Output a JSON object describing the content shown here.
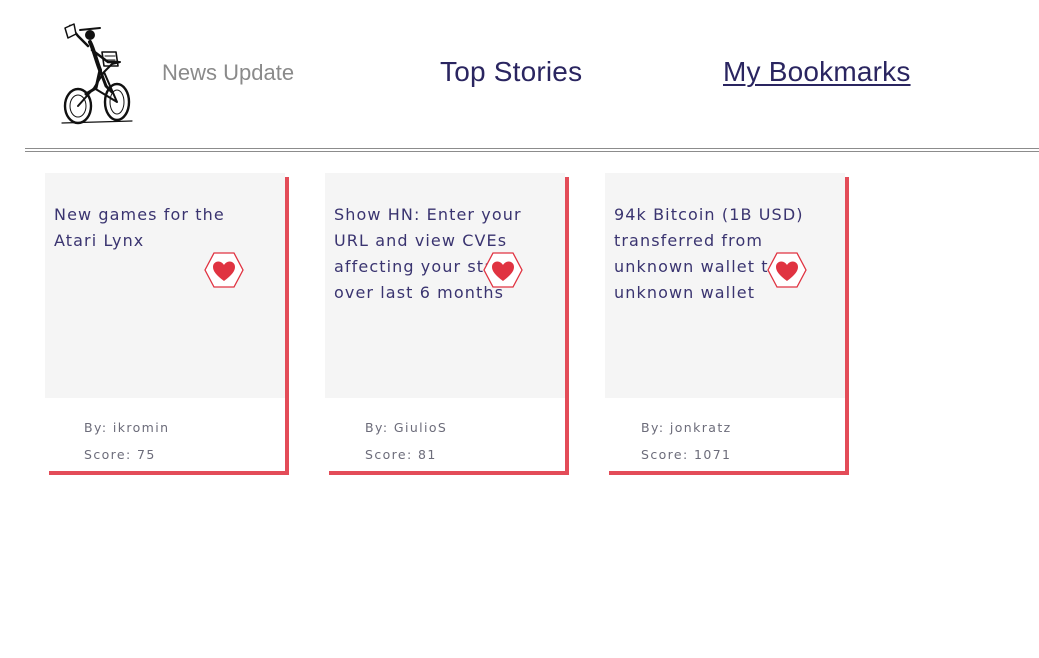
{
  "header": {
    "brand": "News Update",
    "nav": {
      "top_stories": "Top Stories",
      "bookmarks": "My Bookmarks"
    }
  },
  "colors": {
    "nav_text": "#2a2560",
    "card_shadow": "#e34c58",
    "heart": "#e03341",
    "card_bg": "#f5f5f5"
  },
  "stories": [
    {
      "title": "New games for the Atari Lynx",
      "author_prefix": "By:",
      "author": "ikromin",
      "score_prefix": "Score:",
      "score": "75",
      "action_icon": "heart-icon"
    },
    {
      "title": "Show HN: Enter your URL and view CVEs affecting your stack over last 6 months",
      "author_prefix": "By:",
      "author": "GiulioS",
      "score_prefix": "Score:",
      "score": "81",
      "action_icon": "heart-icon"
    },
    {
      "title": "94k Bitcoin (1B USD) transferred from unknown wallet to unknown wallet",
      "author_prefix": "By:",
      "author": "jonkratz",
      "score_prefix": "Score:",
      "score": "1071",
      "action_icon": "heart-icon"
    }
  ]
}
